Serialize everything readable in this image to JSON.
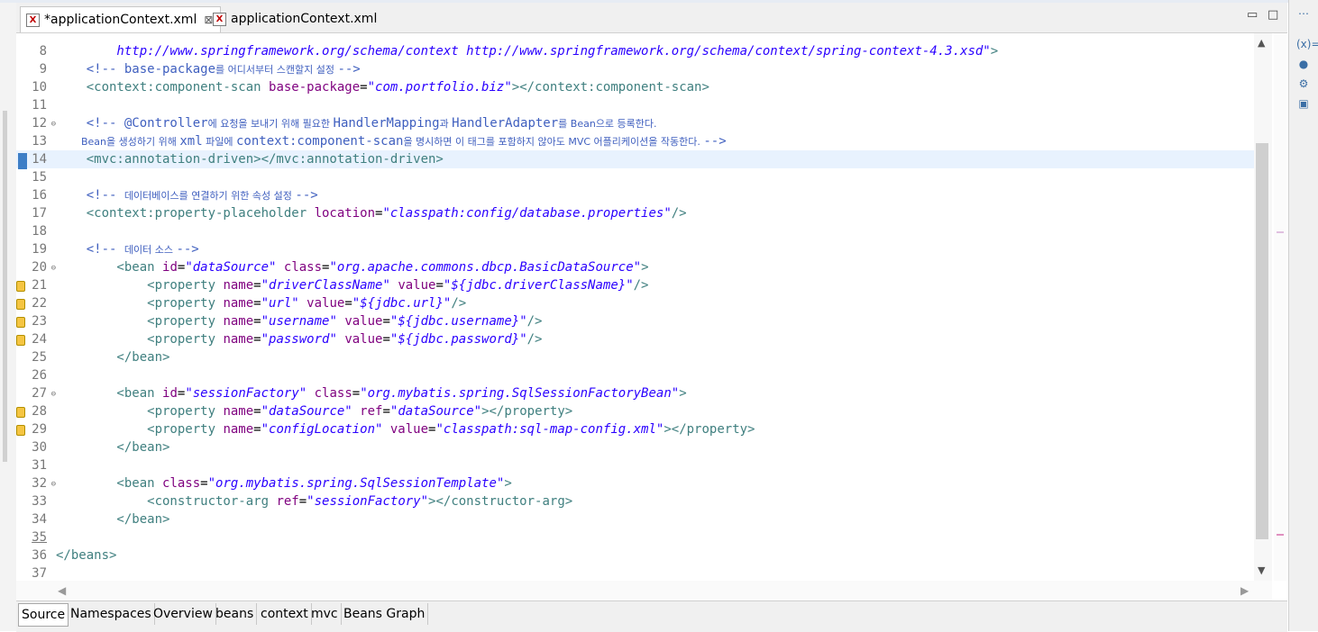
{
  "editor_tabs": [
    {
      "label": "*applicationContext.xml",
      "close": "⊠"
    },
    {
      "label": "applicationContext.xml"
    }
  ],
  "window_controls": {
    "minimize": "▭",
    "maximize": "□"
  },
  "lines": [
    {
      "num": "8",
      "segments": [
        {
          "c": "v",
          "t": "        http://www.springframework.org/schema/context http://www.springframework.org/schema/context/spring-context-4.3.xsd\""
        },
        {
          "c": "t",
          "t": ">"
        }
      ]
    },
    {
      "num": "9",
      "segments": [
        {
          "c": "c",
          "t": "    <!-- base-package"
        },
        {
          "c": "c ko",
          "t": "를 어디서부터 스캔할지 설정 "
        },
        {
          "c": "c",
          "t": "-->"
        }
      ]
    },
    {
      "num": "10",
      "segments": [
        {
          "c": "t",
          "t": "    <context:component-scan "
        },
        {
          "c": "a",
          "t": "base-package"
        },
        {
          "c": "p",
          "t": "="
        },
        {
          "c": "v",
          "t": "\"com.portfolio.biz\""
        },
        {
          "c": "t",
          "t": "></context:component-scan>"
        }
      ]
    },
    {
      "num": "11",
      "segments": []
    },
    {
      "num": "12",
      "fold": true,
      "segments": [
        {
          "c": "c",
          "t": "    <!-- @Controller"
        },
        {
          "c": "c ko",
          "t": "에 요청을 보내기 위해 필요한 "
        },
        {
          "c": "c",
          "t": "HandlerMapping"
        },
        {
          "c": "c ko",
          "t": "과 "
        },
        {
          "c": "c",
          "t": "HandlerAdapter"
        },
        {
          "c": "c ko",
          "t": "를 Bean으로 등록한다."
        }
      ]
    },
    {
      "num": "13",
      "segments": [
        {
          "c": "c ko",
          "t": "        Bean을 생성하기 위해 "
        },
        {
          "c": "c",
          "t": "xml"
        },
        {
          "c": "c ko",
          "t": " 파일에 "
        },
        {
          "c": "c",
          "t": "context:component-scan"
        },
        {
          "c": "c ko",
          "t": "을 명시하면 이 태그를 포함하지 않아도 MVC 어플리케이션을 작동한다. "
        },
        {
          "c": "c",
          "t": "-->"
        }
      ]
    },
    {
      "num": "14",
      "current": true,
      "cursor": true,
      "segments": [
        {
          "c": "t",
          "t": "    <mvc:annotation-driven></mvc:annotation-driven>"
        }
      ]
    },
    {
      "num": "15",
      "segments": []
    },
    {
      "num": "16",
      "segments": [
        {
          "c": "c",
          "t": "    <!-- "
        },
        {
          "c": "c ko",
          "t": "데이터베이스를 연결하기 위한 속성 설정 "
        },
        {
          "c": "c",
          "t": "-->"
        }
      ]
    },
    {
      "num": "17",
      "segments": [
        {
          "c": "t",
          "t": "    <context:property-placeholder "
        },
        {
          "c": "a",
          "t": "location"
        },
        {
          "c": "p",
          "t": "="
        },
        {
          "c": "v",
          "t": "\"classpath:config/database.properties\""
        },
        {
          "c": "t",
          "t": "/>"
        }
      ]
    },
    {
      "num": "18",
      "segments": []
    },
    {
      "num": "19",
      "segments": [
        {
          "c": "c",
          "t": "    <!-- "
        },
        {
          "c": "c ko",
          "t": "데이터 소스 "
        },
        {
          "c": "c",
          "t": "-->"
        }
      ]
    },
    {
      "num": "20",
      "fold": true,
      "segments": [
        {
          "c": "t",
          "t": "        <bean "
        },
        {
          "c": "a",
          "t": "id"
        },
        {
          "c": "p",
          "t": "="
        },
        {
          "c": "v",
          "t": "\"dataSource\""
        },
        {
          "c": "a",
          "t": " class"
        },
        {
          "c": "p",
          "t": "="
        },
        {
          "c": "v",
          "t": "\"org.apache.commons.dbcp.BasicDataSource\""
        },
        {
          "c": "t",
          "t": ">"
        }
      ]
    },
    {
      "num": "21",
      "warn": true,
      "segments": [
        {
          "c": "t",
          "t": "            <property "
        },
        {
          "c": "a",
          "t": "name"
        },
        {
          "c": "p",
          "t": "="
        },
        {
          "c": "v",
          "t": "\"driverClassName\""
        },
        {
          "c": "a",
          "t": " value"
        },
        {
          "c": "p",
          "t": "="
        },
        {
          "c": "v",
          "t": "\"${jdbc.driverClassName}\""
        },
        {
          "c": "t",
          "t": "/>"
        }
      ]
    },
    {
      "num": "22",
      "warn": true,
      "segments": [
        {
          "c": "t",
          "t": "            <property "
        },
        {
          "c": "a",
          "t": "name"
        },
        {
          "c": "p",
          "t": "="
        },
        {
          "c": "v",
          "t": "\"url\""
        },
        {
          "c": "a",
          "t": " value"
        },
        {
          "c": "p",
          "t": "="
        },
        {
          "c": "v",
          "t": "\"${jdbc.url}\""
        },
        {
          "c": "t",
          "t": "/>"
        }
      ]
    },
    {
      "num": "23",
      "warn": true,
      "segments": [
        {
          "c": "t",
          "t": "            <property "
        },
        {
          "c": "a",
          "t": "name"
        },
        {
          "c": "p",
          "t": "="
        },
        {
          "c": "v",
          "t": "\"username\""
        },
        {
          "c": "a",
          "t": " value"
        },
        {
          "c": "p",
          "t": "="
        },
        {
          "c": "v",
          "t": "\"${jdbc.username}\""
        },
        {
          "c": "t",
          "t": "/>"
        }
      ]
    },
    {
      "num": "24",
      "warn": true,
      "segments": [
        {
          "c": "t",
          "t": "            <property "
        },
        {
          "c": "a",
          "t": "name"
        },
        {
          "c": "p",
          "t": "="
        },
        {
          "c": "v",
          "t": "\"password\""
        },
        {
          "c": "a",
          "t": " value"
        },
        {
          "c": "p",
          "t": "="
        },
        {
          "c": "v",
          "t": "\"${jdbc.password}\""
        },
        {
          "c": "t",
          "t": "/>"
        }
      ]
    },
    {
      "num": "25",
      "segments": [
        {
          "c": "t",
          "t": "        </bean>"
        }
      ]
    },
    {
      "num": "26",
      "segments": []
    },
    {
      "num": "27",
      "fold": true,
      "segments": [
        {
          "c": "t",
          "t": "        <bean "
        },
        {
          "c": "a",
          "t": "id"
        },
        {
          "c": "p",
          "t": "="
        },
        {
          "c": "v",
          "t": "\"sessionFactory\""
        },
        {
          "c": "a",
          "t": " class"
        },
        {
          "c": "p",
          "t": "="
        },
        {
          "c": "v",
          "t": "\"org.mybatis.spring.SqlSessionFactoryBean\""
        },
        {
          "c": "t",
          "t": ">"
        }
      ]
    },
    {
      "num": "28",
      "warn": true,
      "segments": [
        {
          "c": "t",
          "t": "            <property "
        },
        {
          "c": "a",
          "t": "name"
        },
        {
          "c": "p",
          "t": "="
        },
        {
          "c": "v",
          "t": "\"dataSource\""
        },
        {
          "c": "a",
          "t": " ref"
        },
        {
          "c": "p",
          "t": "="
        },
        {
          "c": "v",
          "t": "\"dataSource\""
        },
        {
          "c": "t",
          "t": "></property>"
        }
      ]
    },
    {
      "num": "29",
      "warn": true,
      "segments": [
        {
          "c": "t",
          "t": "            <property "
        },
        {
          "c": "a",
          "t": "name"
        },
        {
          "c": "p",
          "t": "="
        },
        {
          "c": "v",
          "t": "\"configLocation\""
        },
        {
          "c": "a",
          "t": " value"
        },
        {
          "c": "p",
          "t": "="
        },
        {
          "c": "v",
          "t": "\"classpath:sql-map-config.xml\""
        },
        {
          "c": "t",
          "t": "></property>"
        }
      ]
    },
    {
      "num": "30",
      "segments": [
        {
          "c": "t",
          "t": "        </bean>"
        }
      ]
    },
    {
      "num": "31",
      "segments": []
    },
    {
      "num": "32",
      "fold": true,
      "segments": [
        {
          "c": "t",
          "t": "        <bean "
        },
        {
          "c": "a",
          "t": "class"
        },
        {
          "c": "p",
          "t": "="
        },
        {
          "c": "v",
          "t": "\"org.mybatis.spring.SqlSessionTemplate\""
        },
        {
          "c": "t",
          "t": ">"
        }
      ]
    },
    {
      "num": "33",
      "segments": [
        {
          "c": "t",
          "t": "            <constructor-arg "
        },
        {
          "c": "a",
          "t": "ref"
        },
        {
          "c": "p",
          "t": "="
        },
        {
          "c": "v",
          "t": "\"sessionFactory\""
        },
        {
          "c": "t",
          "t": "></constructor-arg>"
        }
      ]
    },
    {
      "num": "34",
      "segments": [
        {
          "c": "t",
          "t": "        </bean>"
        }
      ]
    },
    {
      "num": "35",
      "underline": true,
      "segments": []
    },
    {
      "num": "36",
      "segments": [
        {
          "c": "t",
          "t": "</beans>"
        }
      ]
    },
    {
      "num": "37",
      "segments": []
    }
  ],
  "bottom_tabs": [
    "Source",
    "Namespaces",
    "Overview",
    "beans",
    "context",
    "mvc",
    "Beans Graph"
  ],
  "right_toolbar": [
    "⋯",
    "(x)=",
    "●",
    "⚙",
    "▣"
  ],
  "colors": {
    "tag": "#3f7f7f",
    "attribute": "#7f007f",
    "value": "#2a00ff",
    "comment": "#3f5fbf",
    "current_line": "#e8f2fe"
  }
}
